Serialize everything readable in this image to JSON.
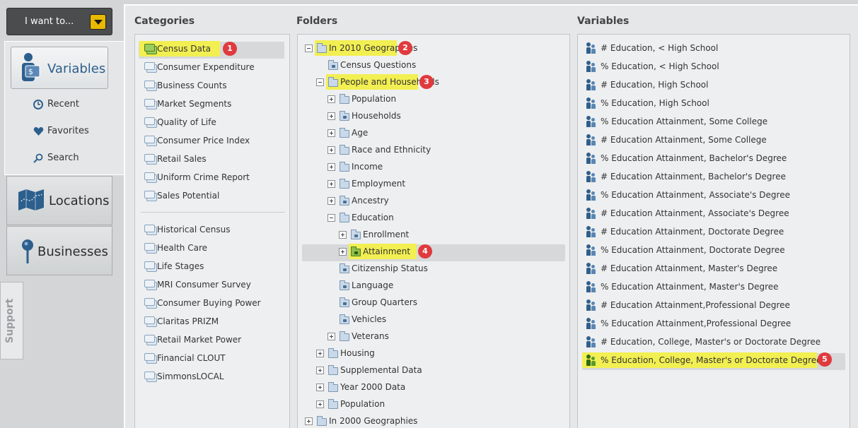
{
  "top_button": {
    "label": "I want to..."
  },
  "nav": {
    "variables": "Variables",
    "sub_items": [
      "Recent",
      "Favorites",
      "Search"
    ],
    "locations": "Locations",
    "businesses": "Businesses",
    "support": "Support"
  },
  "headers": {
    "categories": "Categories",
    "folders": "Folders",
    "variables": "Variables"
  },
  "categories": {
    "group1": [
      "Census Data",
      "Consumer Expenditure",
      "Business Counts",
      "Market Segments",
      "Quality of Life",
      "Consumer Price Index",
      "Retail Sales",
      "Uniform Crime Report",
      "Sales Potential"
    ],
    "group2": [
      "Historical Census",
      "Health Care",
      "Life Stages",
      "MRI Consumer Survey",
      "Consumer Buying Power",
      "Claritas PRIZM",
      "Retail Market Power",
      "Financial CLOUT",
      "SimmonsLOCAL"
    ],
    "selected": "Census Data"
  },
  "folders": [
    "In 2010 Geographies",
    "Census Questions",
    "People and Households",
    "Population",
    "Households",
    "Age",
    "Race and Ethnicity",
    "Income",
    "Employment",
    "Ancestry",
    "Education",
    "Enrollment",
    "Attainment",
    "Citizenship Status",
    "Language",
    "Group Quarters",
    "Vehicles",
    "Veterans",
    "Housing",
    "Supplemental Data",
    "Year 2000 Data",
    "Population",
    "In 2000 Geographies"
  ],
  "variables": [
    "# Education, < High School",
    "% Education, < High School",
    "# Education, High School",
    "% Education, High School",
    "% Education Attainment, Some College",
    "# Education Attainment, Some College",
    "% Education Attainment, Bachelor's Degree",
    "# Education Attainment, Bachelor's Degree",
    "% Education Attainment, Associate's Degree",
    "# Education Attainment, Associate's Degree",
    "# Education Attainment, Doctorate Degree",
    "% Education Attainment, Doctorate Degree",
    "# Education Attainment, Master's Degree",
    "% Education Attainment, Master's Degree",
    "# Education Attainment,Professional Degree",
    "% Education Attainment,Professional Degree",
    "# Education, College, Master's or Doctorate Degree",
    "% Education, College, Master's or Doctorate Degree"
  ],
  "badges": [
    "1",
    "2",
    "3",
    "4",
    "5"
  ],
  "colors": {
    "highlight": "#f2ef52",
    "badge": "#e03a3e",
    "accent_blue": "#2d5f8d",
    "dropdown": "#e8b900"
  }
}
